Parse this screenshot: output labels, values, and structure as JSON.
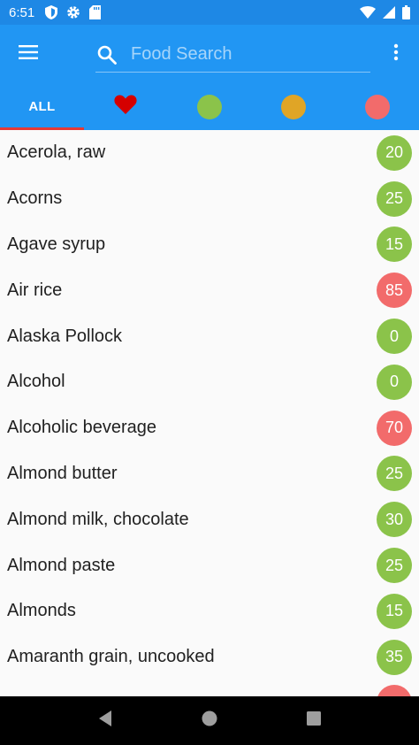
{
  "status_bar": {
    "time": "6:51",
    "left_icons": [
      "shield-icon",
      "gear-icon",
      "sd-card-icon"
    ],
    "right_icons": [
      "wifi-icon",
      "signal-icon",
      "battery-icon"
    ]
  },
  "app_bar": {
    "menu_icon": "hamburger-menu-icon",
    "search": {
      "placeholder": "Food Search",
      "value": ""
    },
    "overflow_icon": "more-vert-icon"
  },
  "tabs": [
    {
      "kind": "label",
      "label": "ALL",
      "selected": true
    },
    {
      "kind": "icon",
      "icon": "heart-icon",
      "color": "#d50000"
    },
    {
      "kind": "dot",
      "name": "green",
      "color": "#8bc34a"
    },
    {
      "kind": "dot",
      "name": "yellow",
      "color": "#e0a526"
    },
    {
      "kind": "dot",
      "name": "red",
      "color": "#f26b6b"
    }
  ],
  "colors": {
    "primary": "#2196f3",
    "status_bar": "#1e88e5",
    "indicator": "#e53935",
    "low": "#8bc34a",
    "high": "#f26b6b"
  },
  "foods": [
    {
      "name": "Acerola, raw",
      "value": "20",
      "level": "low"
    },
    {
      "name": "Acorns",
      "value": "25",
      "level": "low"
    },
    {
      "name": "Agave syrup",
      "value": "15",
      "level": "low"
    },
    {
      "name": "Air rice",
      "value": "85",
      "level": "high"
    },
    {
      "name": "Alaska Pollock",
      "value": "0",
      "level": "low"
    },
    {
      "name": "Alcohol",
      "value": "0",
      "level": "low"
    },
    {
      "name": "Alcoholic beverage",
      "value": "70",
      "level": "high"
    },
    {
      "name": "Almond butter",
      "value": "25",
      "level": "low"
    },
    {
      "name": "Almond milk, chocolate",
      "value": "30",
      "level": "low"
    },
    {
      "name": "Almond paste",
      "value": "25",
      "level": "low"
    },
    {
      "name": "Almonds",
      "value": "15",
      "level": "low"
    },
    {
      "name": "Amaranth grain, uncooked",
      "value": "35",
      "level": "low"
    },
    {
      "name": "",
      "value": "",
      "level": "high"
    }
  ],
  "nav_bar": {
    "buttons": [
      "back-icon",
      "home-icon",
      "recents-icon"
    ]
  }
}
